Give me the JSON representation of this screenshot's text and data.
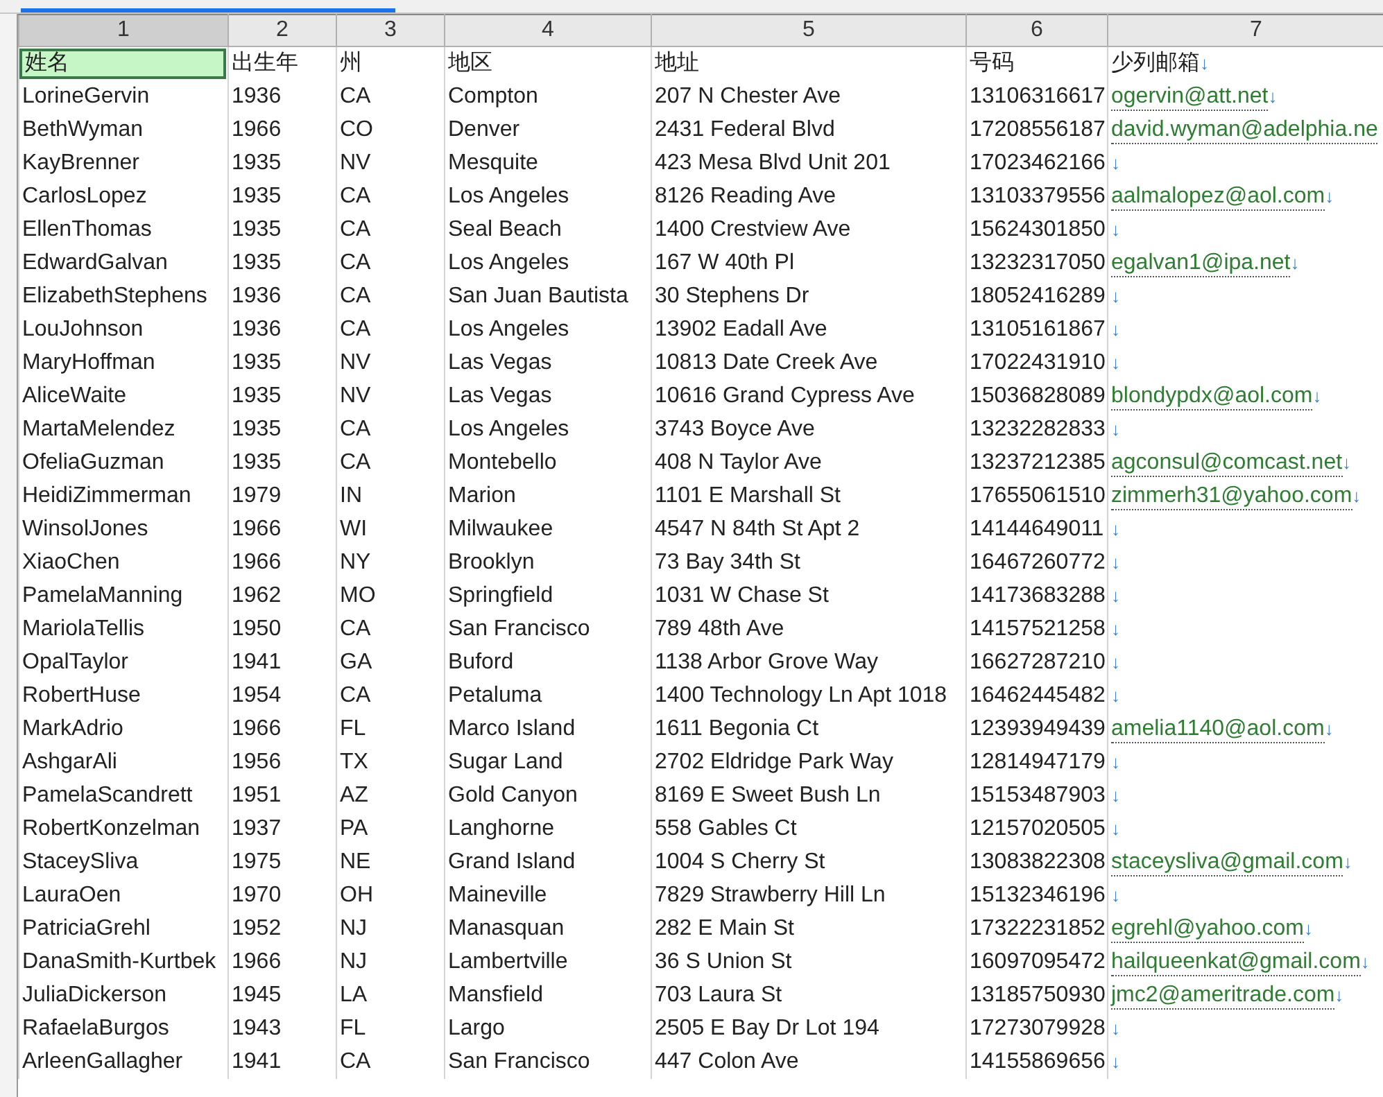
{
  "columns": [
    {
      "label": "1",
      "selected": true
    },
    {
      "label": "2",
      "selected": false
    },
    {
      "label": "3",
      "selected": false
    },
    {
      "label": "4",
      "selected": false
    },
    {
      "label": "5",
      "selected": false
    },
    {
      "label": "6",
      "selected": false
    },
    {
      "label": "7",
      "selected": false
    }
  ],
  "header_row": [
    {
      "text": "姓名",
      "selected": true
    },
    {
      "text": "出生年",
      "selected": false
    },
    {
      "text": "州",
      "selected": false
    },
    {
      "text": "地区",
      "selected": false
    },
    {
      "text": "地址",
      "selected": false
    },
    {
      "text": "号码",
      "selected": false
    },
    {
      "text": "少列邮箱",
      "selected": false,
      "end_mark": "↓"
    }
  ],
  "rows": [
    {
      "cells": [
        "LorineGervin",
        "1936",
        "CA",
        "Compton",
        "207 N Chester Ave",
        "13106316617"
      ],
      "email": "ogervin@att.net",
      "end_mark": "↓"
    },
    {
      "cells": [
        "BethWyman",
        "1966",
        "CO",
        "Denver",
        "2431 Federal Blvd",
        "17208556187"
      ],
      "email": "david.wyman@adelphia.ne"
    },
    {
      "cells": [
        "KayBrenner",
        "1935",
        "NV",
        "Mesquite",
        "423 Mesa Blvd Unit 201",
        "17023462166"
      ],
      "end_mark": "↓"
    },
    {
      "cells": [
        "CarlosLopez",
        "1935",
        "CA",
        "Los Angeles",
        "8126 Reading Ave",
        "13103379556"
      ],
      "email": "aalmalopez@aol.com",
      "end_mark": "↓"
    },
    {
      "cells": [
        "EllenThomas",
        "1935",
        "CA",
        "Seal Beach",
        "1400 Crestview Ave",
        "15624301850"
      ],
      "end_mark": "↓"
    },
    {
      "cells": [
        "EdwardGalvan",
        "1935",
        "CA",
        "Los Angeles",
        "167 W 40th Pl",
        "13232317050"
      ],
      "email": "egalvan1@ipa.net",
      "end_mark": "↓"
    },
    {
      "cells": [
        "ElizabethStephens",
        "1936",
        "CA",
        "San Juan Bautista",
        "30 Stephens Dr",
        "18052416289"
      ],
      "end_mark": "↓"
    },
    {
      "cells": [
        "LouJohnson",
        "1936",
        "CA",
        "Los Angeles",
        "13902 Eadall Ave",
        "13105161867"
      ],
      "end_mark": "↓"
    },
    {
      "cells": [
        "MaryHoffman",
        "1935",
        "NV",
        "Las Vegas",
        "10813 Date Creek Ave",
        "17022431910"
      ],
      "end_mark": "↓"
    },
    {
      "cells": [
        "AliceWaite",
        "1935",
        "NV",
        "Las Vegas",
        "10616 Grand Cypress Ave",
        "15036828089"
      ],
      "email": "blondypdx@aol.com",
      "end_mark": "↓"
    },
    {
      "cells": [
        "MartaMelendez",
        "1935",
        "CA",
        "Los Angeles",
        "3743 Boyce Ave",
        "13232282833"
      ],
      "end_mark": "↓"
    },
    {
      "cells": [
        "OfeliaGuzman",
        "1935",
        "CA",
        "Montebello",
        "408 N Taylor Ave",
        "13237212385"
      ],
      "email": "agconsul@comcast.net",
      "end_mark": "↓"
    },
    {
      "cells": [
        "HeidiZimmerman",
        "1979",
        "IN",
        "Marion",
        "1101 E Marshall St",
        "17655061510"
      ],
      "email": "zimmerh31@yahoo.com",
      "end_mark": "↓"
    },
    {
      "cells": [
        "WinsolJones",
        "1966",
        "WI",
        "Milwaukee",
        "4547 N 84th St Apt 2",
        "14144649011"
      ],
      "end_mark": "↓"
    },
    {
      "cells": [
        "XiaoChen",
        "1966",
        "NY",
        "Brooklyn",
        "73 Bay 34th St",
        "16467260772"
      ],
      "end_mark": "↓"
    },
    {
      "cells": [
        "PamelaManning",
        "1962",
        "MO",
        "Springfield",
        "1031 W Chase St",
        "14173683288"
      ],
      "end_mark": "↓"
    },
    {
      "cells": [
        "MariolaTellis",
        "1950",
        "CA",
        "San Francisco",
        "789 48th Ave",
        "14157521258"
      ],
      "end_mark": "↓"
    },
    {
      "cells": [
        "OpalTaylor",
        "1941",
        "GA",
        "Buford",
        "1138 Arbor Grove Way",
        "16627287210"
      ],
      "end_mark": "↓"
    },
    {
      "cells": [
        "RobertHuse",
        "1954",
        "CA",
        "Petaluma",
        "1400 Technology Ln Apt 1018",
        "16462445482"
      ],
      "end_mark": "↓"
    },
    {
      "cells": [
        "MarkAdrio",
        "1966",
        "FL",
        "Marco Island",
        "1611 Begonia Ct",
        "12393949439"
      ],
      "email": "amelia1140@aol.com",
      "end_mark": "↓"
    },
    {
      "cells": [
        "AshgarAli",
        "1956",
        "TX",
        "Sugar Land",
        "2702 Eldridge Park Way",
        "12814947179"
      ],
      "end_mark": "↓"
    },
    {
      "cells": [
        "PamelaScandrett",
        "1951",
        "AZ",
        "Gold Canyon",
        "8169 E Sweet Bush Ln",
        "15153487903"
      ],
      "end_mark": "↓"
    },
    {
      "cells": [
        "RobertKonzelman",
        "1937",
        "PA",
        "Langhorne",
        "558 Gables Ct",
        "12157020505"
      ],
      "end_mark": "↓"
    },
    {
      "cells": [
        "StaceySliva",
        "1975",
        "NE",
        "Grand Island",
        "1004 S Cherry St",
        "13083822308"
      ],
      "email": "staceysliva@gmail.com",
      "end_mark": "↓"
    },
    {
      "cells": [
        "LauraOen",
        "1970",
        "OH",
        "Maineville",
        "7829 Strawberry Hill Ln",
        "15132346196"
      ],
      "end_mark": "↓"
    },
    {
      "cells": [
        "PatriciaGrehl",
        "1952",
        "NJ",
        "Manasquan",
        "282 E Main St",
        "17322231852"
      ],
      "email": "egrehl@yahoo.com",
      "end_mark": "↓"
    },
    {
      "cells": [
        "DanaSmith-Kurtbek",
        "1966",
        "NJ",
        "Lambertville",
        "36 S Union St",
        "16097095472"
      ],
      "email": "hailqueenkat@gmail.com",
      "end_mark": "↓"
    },
    {
      "cells": [
        "JuliaDickerson",
        "1945",
        "LA",
        "Mansfield",
        "703 Laura St",
        "13185750930"
      ],
      "email": "jmc2@ameritrade.com",
      "end_mark": "↓"
    },
    {
      "cells": [
        "RafaelaBurgos",
        "1943",
        "FL",
        "Largo",
        "2505 E Bay Dr Lot 194",
        "17273079928"
      ],
      "end_mark": "↓"
    },
    {
      "cells": [
        "ArleenGallagher",
        "1941",
        "CA",
        "San Francisco",
        "447 Colon Ave",
        "14155869656"
      ],
      "end_mark": "↓"
    }
  ]
}
